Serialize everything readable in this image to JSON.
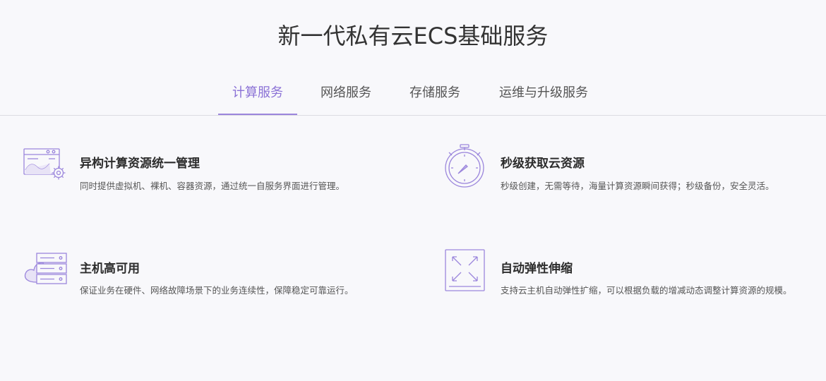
{
  "page": {
    "title": "新一代私有云ECS基础服务"
  },
  "tabs": [
    {
      "label": "计算服务",
      "active": true
    },
    {
      "label": "网络服务",
      "active": false
    },
    {
      "label": "存储服务",
      "active": false
    },
    {
      "label": "运维与升级服务",
      "active": false
    }
  ],
  "features": [
    {
      "icon": "dashboard-gear-icon",
      "title": "异构计算资源统一管理",
      "desc": "同时提供虚拟机、裸机、容器资源，通过统一自服务界面进行管理。"
    },
    {
      "icon": "stopwatch-icon",
      "title": "秒级获取云资源",
      "desc": "秒级创建，无需等待，海量计算资源瞬间获得；秒级备份，安全灵活。"
    },
    {
      "icon": "cloud-server-icon",
      "title": "主机高可用",
      "desc": "保证业务在硬件、网络故障场景下的业务连续性，保障稳定可靠运行。"
    },
    {
      "icon": "expand-arrows-icon",
      "title": "自动弹性伸缩",
      "desc": "支持云主机自动弹性扩缩，可以根据负载的增减动态调整计算资源的规模。"
    }
  ],
  "colors": {
    "accent": "#8b72d6",
    "icon_stroke": "#9b86dc",
    "background": "#f8f8fb"
  }
}
